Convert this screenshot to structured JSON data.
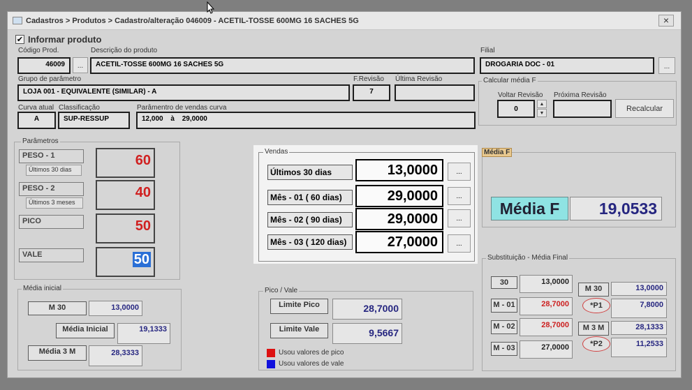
{
  "window": {
    "title": "Cadastros > Produtos > Cadastro/alteração  046009 - ACETIL-TOSSE 600MG 16 SACHES 5G",
    "close_glyph": "×"
  },
  "header": {
    "checkbox_checked": true,
    "checkbox_glyph": "✔",
    "title": "Informar produto"
  },
  "produto": {
    "codigo_label": "Código Prod.",
    "codigo_value": "46009",
    "descricao_label": "Descrição do  produto",
    "descricao_value": "ACETIL-TOSSE 600MG 16 SACHES 5G",
    "browse_label": "...",
    "filial_label": "Filial",
    "filial_value": "DROGARIA DOC - 01",
    "grupo_label": "Grupo de parâmetro",
    "grupo_value": "LOJA 001 - EQUIVALENTE (SIMILAR) - A",
    "frevisao_label": "F.Revisão",
    "frevisao_value": "7",
    "ultima_revisao_label": "Última Revisão",
    "ultima_revisao_value": "",
    "curva_label": "Curva atual",
    "curva_value": "A",
    "classificacao_label": "Classificação",
    "classificacao_value": "SUP-RESSUP",
    "param_vendas_label": "Parâmentro de vendas curva",
    "param_vendas_from": "12,000",
    "param_vendas_sep": "à",
    "param_vendas_to": "29,0000"
  },
  "calcular": {
    "title": "Calcular média F",
    "voltar_label": "Voltar Revisão",
    "voltar_value": "0",
    "proxima_label": "Próxima Revisão",
    "proxima_value": "",
    "spin_up": "▲",
    "spin_down": "▼",
    "recalcular_label": "Recalcular"
  },
  "parametros": {
    "title": "Parâmetros",
    "items": [
      {
        "label": "PESO - 1",
        "sub": "Últimos 30 dias",
        "value": "60"
      },
      {
        "label": "PESO - 2",
        "sub": "Últimos 3 meses",
        "value": "40"
      },
      {
        "label": "PICO",
        "sub": "",
        "value": "50"
      },
      {
        "label": "VALE",
        "sub": "",
        "value": "50"
      }
    ]
  },
  "vendas": {
    "title": "Vendas",
    "rows": [
      {
        "label": "Últimos 30 dias",
        "value": "13,0000",
        "btn": "..."
      },
      {
        "label": "Mês - 01 ( 60 dias)",
        "value": "29,0000",
        "btn": "..."
      },
      {
        "label": "Mês - 02 ( 90 dias)",
        "value": "29,0000",
        "btn": "..."
      },
      {
        "label": "Mês - 03 ( 120 dias)",
        "value": "27,0000",
        "btn": "..."
      }
    ]
  },
  "media_f": {
    "title": "Média F",
    "label": "Média F",
    "value": "19,0533"
  },
  "media_inicial": {
    "title": "Média inicial",
    "m30_label": "M 30",
    "m30_value": "13,0000",
    "inicial_label": "Média Inicial",
    "inicial_value": "19,1333",
    "m3m_label": "Média 3 M",
    "m3m_value": "28,3333"
  },
  "pico_vale": {
    "title": "Pico / Vale",
    "pico_label": "Limite Pico",
    "pico_value": "28,7000",
    "vale_label": "Limite Vale",
    "vale_value": "9,5667",
    "legend_pico": "Usou valores de pico",
    "legend_vale": "Usou valores de vale",
    "color_pico": "#dd1111",
    "color_vale": "#1111dd"
  },
  "substituicao": {
    "title": "Substituição - Média Final",
    "left": [
      {
        "label": "30",
        "value": "13,0000",
        "color": "dark"
      },
      {
        "label": "M - 01",
        "value": "28,7000",
        "color": "red"
      },
      {
        "label": "M - 02",
        "value": "28,7000",
        "color": "red"
      },
      {
        "label": "M - 03",
        "value": "27,0000",
        "color": "dark"
      }
    ],
    "right": [
      {
        "label": "M 30",
        "value": "13,0000",
        "circled": false
      },
      {
        "label": "*P1",
        "value": "7,8000",
        "circled": true
      },
      {
        "label": "M 3 M",
        "value": "28,1333",
        "circled": false
      },
      {
        "label": "*P2",
        "value": "11,2533",
        "circled": true
      }
    ]
  }
}
